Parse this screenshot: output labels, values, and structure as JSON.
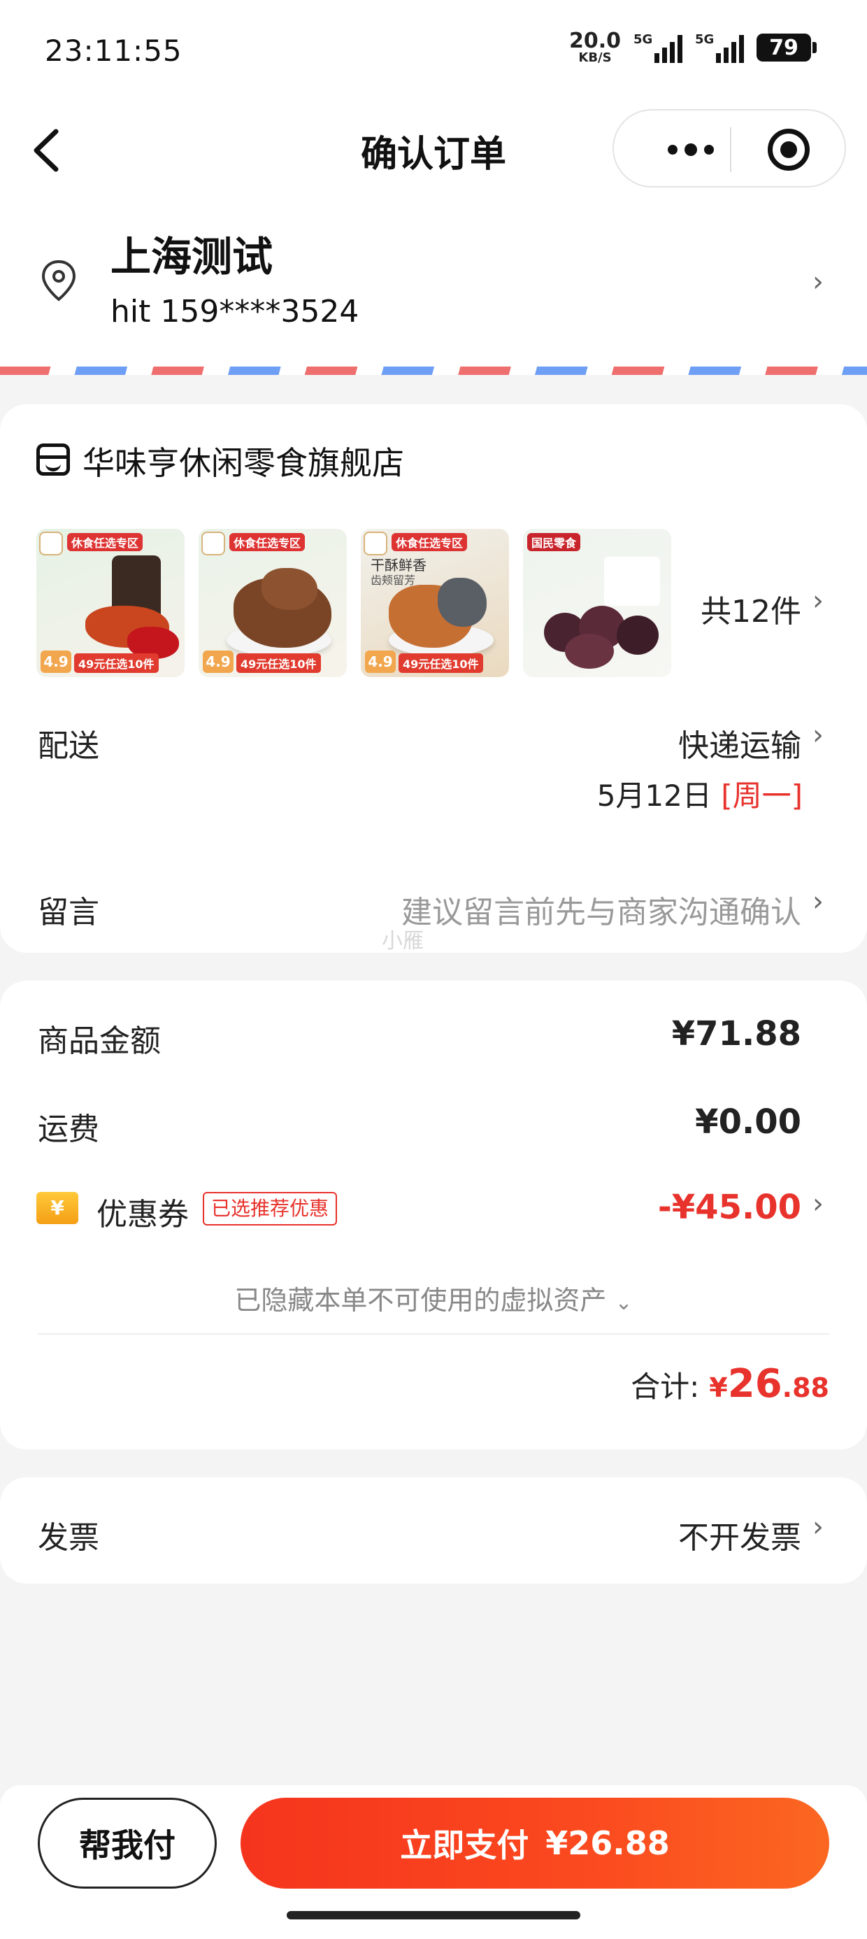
{
  "status": {
    "time": "23:11:55",
    "net_speed": "20.0",
    "net_unit": "KB/S",
    "sig1": "5G",
    "sig2": "5G",
    "battery": "79"
  },
  "nav": {
    "title": "确认订单"
  },
  "address": {
    "name": "上海测试",
    "phone": "hit 159****3524"
  },
  "store": {
    "name": "华味亨休闲零食旗舰店",
    "products": [
      {
        "tag": "休食任选专区",
        "rating": "4.9",
        "promo": "49元任选10件"
      },
      {
        "tag": "休食任选专区",
        "rating": "4.9",
        "promo": "49元任选10件"
      },
      {
        "tag": "休食任选专区",
        "text": "干酥鲜香",
        "subtext": "齿颊留芳",
        "rating": "4.9",
        "promo": "49元任选10件"
      },
      {
        "tag": "国民零食"
      }
    ],
    "count": "共12件"
  },
  "delivery": {
    "label": "配送",
    "method": "快递运输",
    "date": "5月12日",
    "weekday": "[周一]"
  },
  "message": {
    "label": "留言",
    "hint": "建议留言前先与商家沟通确认",
    "watermark": "小雁"
  },
  "price": {
    "goods_label": "商品金额",
    "goods_value": "¥71.88",
    "shipping_label": "运费",
    "shipping_value": "¥0.00",
    "coupon_label": "优惠券",
    "coupon_badge": "已选推荐优惠",
    "coupon_value": "-¥45.00",
    "hidden_assets": "已隐藏本单不可使用的虚拟资产",
    "total_label": "合计:",
    "total_currency": "¥",
    "total_int": "26",
    "total_dec": ".88"
  },
  "invoice": {
    "label": "发票",
    "value": "不开发票"
  },
  "bottom": {
    "help": "帮我付",
    "pay_label": "立即支付",
    "pay_amount": "¥26.88"
  },
  "colors": {
    "accent": "#e8322c",
    "pay_gradient_start": "#f5341d",
    "pay_gradient_end": "#fb6721",
    "background": "#f4f4f4"
  }
}
